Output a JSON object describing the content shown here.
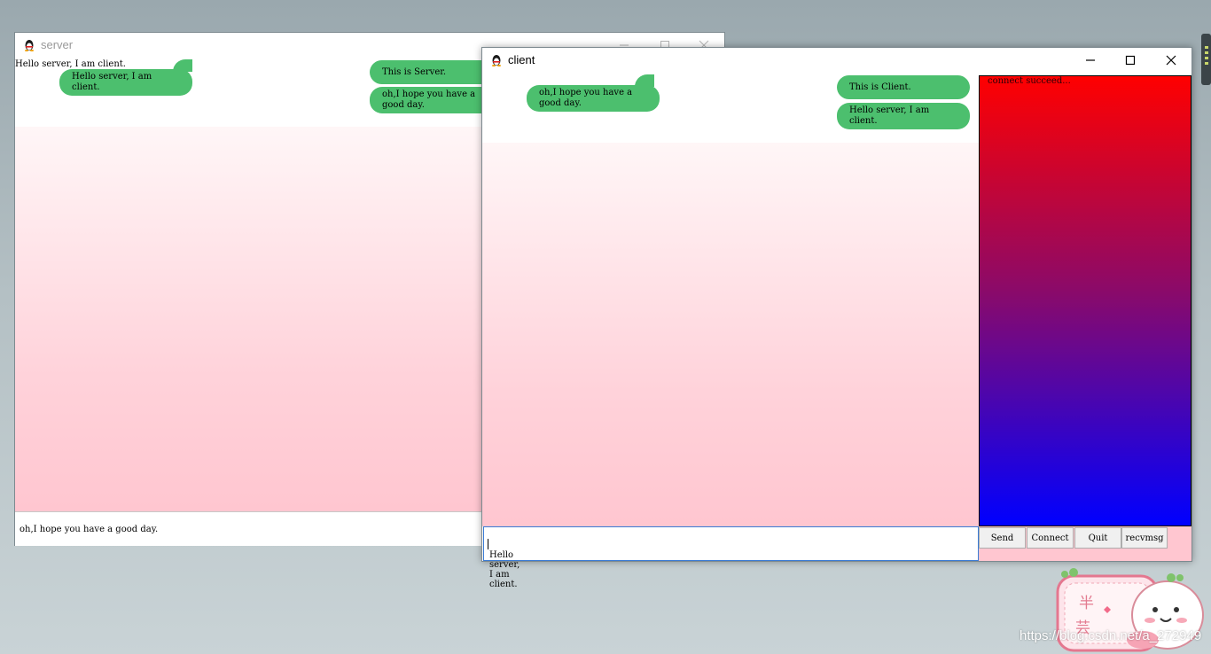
{
  "server": {
    "title": "server",
    "plain_message": "Hello server, I am client.",
    "received_bubbles": [
      "Hello server, I am client."
    ],
    "sent_bubbles": [
      "This is Server.",
      "oh,I hope you have a good day."
    ],
    "input_value": "oh,I hope you have a good day."
  },
  "client": {
    "title": "client",
    "received_bubbles": [
      "oh,I hope you have a good day."
    ],
    "sent_bubbles": [
      "This is Client.",
      "Hello server, I am client."
    ],
    "input_value": "Hello server, I am client.",
    "status_text": "connect succeed...",
    "buttons": {
      "send": "Send",
      "connect": "Connect",
      "quit": "Quit",
      "recvmsg": "recvmsg"
    }
  },
  "sticker": {
    "chars": [
      "半",
      "芸"
    ]
  },
  "watermark": "https://blog.csdn.net/a_272949",
  "colors": {
    "bubble": "#4cbf6e",
    "panel_top": "#ff0000",
    "panel_bottom": "#0000ff",
    "chat_bg_bottom": "#ffc6d0"
  },
  "icons": [
    "qq-penguin-icon",
    "minimize-icon",
    "maximize-icon",
    "close-icon"
  ]
}
